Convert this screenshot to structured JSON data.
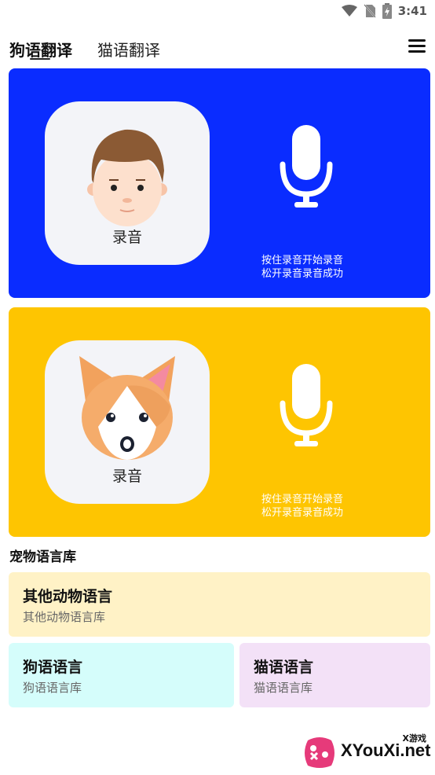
{
  "status_bar": {
    "time": "3:41",
    "icons": [
      "wifi-icon",
      "no-sim-icon",
      "battery-icon"
    ]
  },
  "tabs": [
    {
      "label": "狗语翻译",
      "active": true
    },
    {
      "label": "猫语翻译",
      "active": false
    }
  ],
  "menu": {
    "icon": "hamburger-menu-icon"
  },
  "record_cards": [
    {
      "color": "#0a2cff",
      "avatar": "boy-face-icon",
      "button_label": "录音",
      "hint_line1": "按住录音开始录音",
      "hint_line2": "松开录音录音成功"
    },
    {
      "color": "#fec501",
      "avatar": "corgi-face-icon",
      "button_label": "录音",
      "hint_line1": "按住录音开始录音",
      "hint_line2": "松开录音录音成功"
    }
  ],
  "library": {
    "title": "宠物语言库",
    "items": [
      {
        "title": "其他动物语言",
        "subtitle": "其他动物语言库",
        "color": "#fff2c6"
      },
      {
        "title": "狗语语言",
        "subtitle": "狗语语言库",
        "color": "#d5fdfb"
      },
      {
        "title": "猫语语言",
        "subtitle": "猫语语言库",
        "color": "#f3e1f7"
      }
    ]
  },
  "watermark": {
    "text": "XYouXi.net",
    "small": "X游戏"
  }
}
